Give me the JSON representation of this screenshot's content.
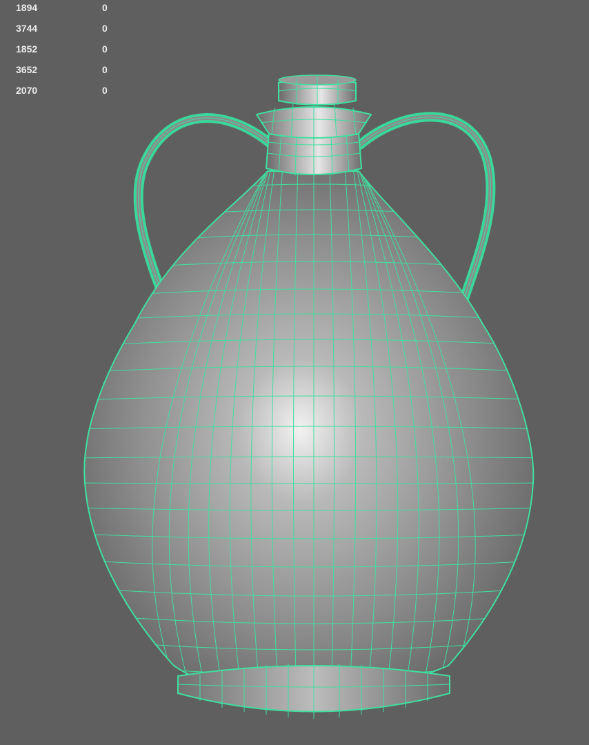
{
  "hud": {
    "rows": [
      {
        "value": "1894",
        "count": "0"
      },
      {
        "value": "3744",
        "count": "0"
      },
      {
        "value": "1852",
        "count": "0"
      },
      {
        "value": "3652",
        "count": "0"
      },
      {
        "value": "2070",
        "count": "0"
      }
    ]
  },
  "colors": {
    "background": "#5f5f5f",
    "wireframe": "#3fe0a0",
    "hud_text": "#ececec"
  },
  "scene": {
    "object": "amphora-mesh",
    "display_mode": "shaded-with-wireframe"
  }
}
